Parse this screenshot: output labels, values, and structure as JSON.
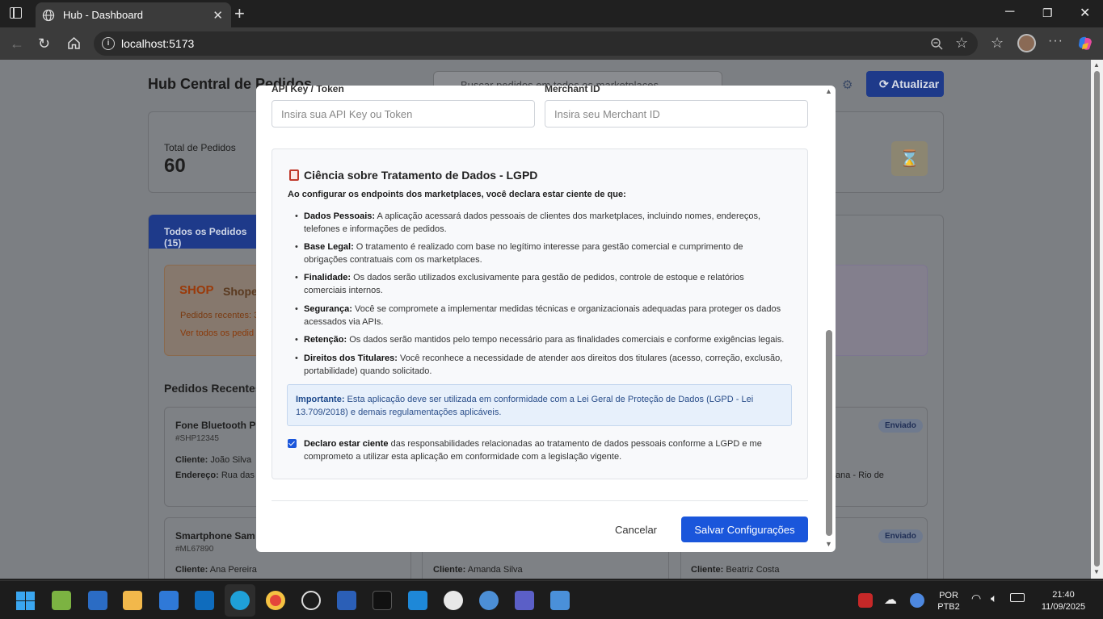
{
  "browser": {
    "tab_title": "Hub - Dashboard",
    "url": "localhost:5173"
  },
  "background": {
    "app_title": "Hub Central de Pedidos",
    "search_placeholder": "Buscar pedidos em todos os marketplaces",
    "refresh_label": "Atualizar",
    "total_label": "Total de Pedidos",
    "total_value": "60",
    "tab_all": "Todos os Pedidos (15)",
    "shop_logo": "SHOP",
    "shop_name": "Shope",
    "shop_recent": "Pedidos recentes: 3",
    "shop_view_all": "Ver todos os pedid",
    "recent_heading": "Pedidos Recentes",
    "order1_name": "Fone Bluetooth P",
    "order1_id": "#SHP12345",
    "order1_client_label": "Cliente:",
    "order1_client": "João Silva",
    "order1_address_label": "Endereço:",
    "order1_address": "Rua das F",
    "order2_name": "Smartphone Sam",
    "order2_id": "#ML67890",
    "order2_client_label": "Cliente:",
    "order2_client": "Ana Pereira",
    "order3_client_label": "Cliente:",
    "order3_client": "Amanda Silva",
    "order4_client_label": "Cliente:",
    "order4_client": "Beatriz Costa",
    "order_right_address": "ana - Rio de",
    "status_badge_1": "Enviado",
    "status_badge_2": "Enviado"
  },
  "modal": {
    "api_key_label": "API Key / Token",
    "api_key_placeholder": "Insira sua API Key ou Token",
    "merchant_label": "Merchant ID",
    "merchant_placeholder": "Insira seu Merchant ID",
    "lgpd_title": "Ciência sobre Tratamento de Dados - LGPD",
    "lgpd_intro": "Ao configurar os endpoints dos marketplaces, você declara estar ciente de que:",
    "items": [
      {
        "term": "Dados Pessoais:",
        "text": " A aplicação acessará dados pessoais de clientes dos marketplaces, incluindo nomes, endereços, telefones e informações de pedidos."
      },
      {
        "term": "Base Legal:",
        "text": " O tratamento é realizado com base no legítimo interesse para gestão comercial e cumprimento de obrigações contratuais com os marketplaces."
      },
      {
        "term": "Finalidade:",
        "text": " Os dados serão utilizados exclusivamente para gestão de pedidos, controle de estoque e relatórios comerciais internos."
      },
      {
        "term": "Segurança:",
        "text": " Você se compromete a implementar medidas técnicas e organizacionais adequadas para proteger os dados acessados via APIs."
      },
      {
        "term": "Retenção:",
        "text": " Os dados serão mantidos pelo tempo necessário para as finalidades comerciais e conforme exigências legais."
      },
      {
        "term": "Direitos dos Titulares:",
        "text": " Você reconhece a necessidade de atender aos direitos dos titulares (acesso, correção, exclusão, portabilidade) quando solicitado."
      }
    ],
    "important_term": "Importante:",
    "important_text": " Esta aplicação deve ser utilizada em conformidade com a Lei Geral de Proteção de Dados (LGPD - Lei 13.709/2018) e demais regulamentações aplicáveis.",
    "declare_term": "Declaro estar ciente",
    "declare_text": " das responsabilidades relacionadas ao tratamento de dados pessoais conforme a LGPD e me comprometo a utilizar esta aplicação em conformidade com a legislação vigente.",
    "declare_checked": true,
    "cancel_label": "Cancelar",
    "save_label": "Salvar Configurações"
  },
  "taskbar": {
    "lang_top": "POR",
    "lang_bottom": "PTB2",
    "time": "21:40",
    "date": "11/09/2025"
  },
  "colors": {
    "primary": "#1a56db",
    "overlay": "#7c7f83",
    "important_bg": "#e7f0fb"
  }
}
